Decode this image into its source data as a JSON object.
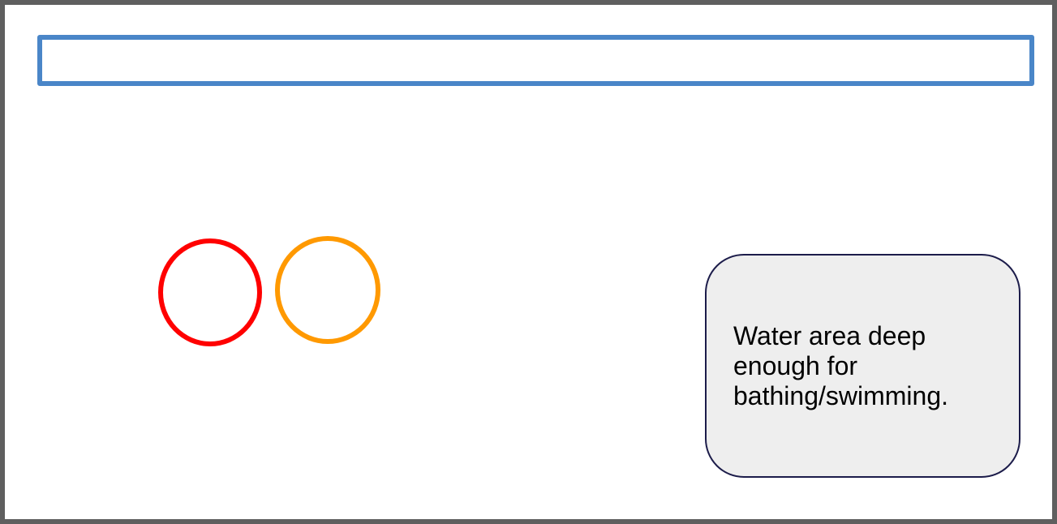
{
  "legend": {
    "description": "Water area deep enough for bathing/swimming."
  },
  "colors": {
    "frame_border": "#5f5f5f",
    "top_bar_border": "#4a86c8",
    "circle_1": "#ff0000",
    "circle_2": "#ff9900",
    "info_box_fill": "#eeeeee",
    "info_box_border": "#1c1c4a"
  }
}
